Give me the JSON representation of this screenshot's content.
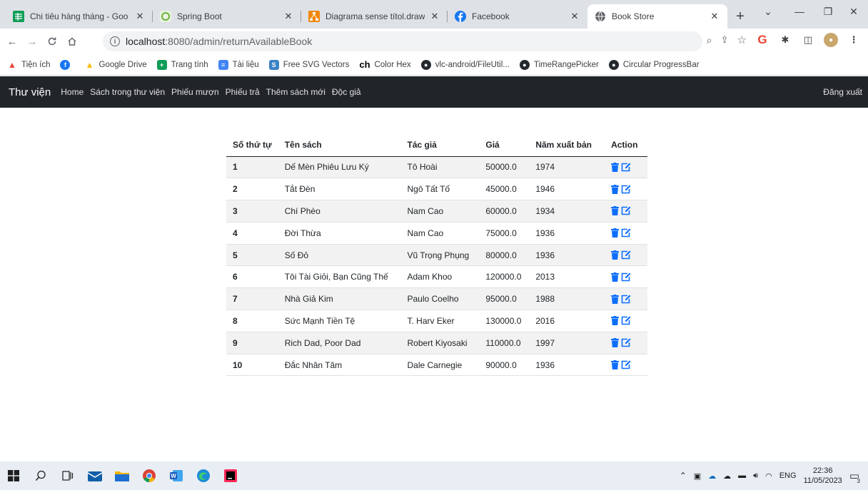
{
  "browser": {
    "tabs": [
      {
        "title": "Chi tiêu hàng tháng - Goo",
        "favicon": "sheets-icon",
        "color": "#0f9d58"
      },
      {
        "title": "Spring Boot",
        "favicon": "spring-icon",
        "color": "#6db33f"
      },
      {
        "title": "Diagrama sense títol.draw",
        "favicon": "drawio-icon",
        "color": "#f08705"
      },
      {
        "title": "Facebook",
        "favicon": "facebook-icon",
        "color": "#1877f2"
      },
      {
        "title": "Book Store",
        "favicon": "globe-icon",
        "color": "#5f6368"
      }
    ],
    "url_host": "localhost",
    "url_path": ":8080/admin/returnAvailableBook",
    "bookmarks": [
      {
        "label": "Tiện ích",
        "icon": "apps-icon",
        "color": "#ea4335"
      },
      {
        "label": "",
        "icon": "facebook-icon",
        "color": "#1877f2"
      },
      {
        "label": "Google Drive",
        "icon": "drive-icon",
        "color": "#fbbc04"
      },
      {
        "label": "Trang tính",
        "icon": "sheets-icon",
        "color": "#0f9d58"
      },
      {
        "label": "Tài liệu",
        "icon": "docs-icon",
        "color": "#4285f4"
      },
      {
        "label": "Free SVG Vectors",
        "icon": "svg-icon",
        "color": "#3b82c4"
      },
      {
        "label": "Color Hex",
        "icon": "colorhex-icon",
        "color": "#000000"
      },
      {
        "label": "vlc-android/FileUtil...",
        "icon": "github-icon",
        "color": "#24292f"
      },
      {
        "label": "TimeRangePicker",
        "icon": "github-icon",
        "color": "#24292f"
      },
      {
        "label": "Circular ProgressBar",
        "icon": "github-icon",
        "color": "#24292f"
      }
    ]
  },
  "navbar": {
    "brand": "Thư viện",
    "links": [
      "Home",
      "Sách trong thư viện",
      "Phiếu mượn",
      "Phiếu trả",
      "Thêm sách mới",
      "Độc giả"
    ],
    "logout": "Đăng xuất",
    "bg_color": "#212529"
  },
  "table": {
    "headers": [
      "Số thứ tự",
      "Tên sách",
      "Tác giả",
      "Giá",
      "Năm xuất bản",
      "Action"
    ],
    "rows": [
      [
        "1",
        "Dế Mèn Phiêu Lưu Ký",
        "Tô Hoài",
        "50000.0",
        "1974"
      ],
      [
        "2",
        "Tắt Đèn",
        "Ngô Tất Tố",
        "45000.0",
        "1946"
      ],
      [
        "3",
        "Chí Phèo",
        "Nam Cao",
        "60000.0",
        "1934"
      ],
      [
        "4",
        "Đời Thừa",
        "Nam Cao",
        "75000.0",
        "1936"
      ],
      [
        "5",
        "Số Đỏ",
        "Vũ Trọng Phụng",
        "80000.0",
        "1936"
      ],
      [
        "6",
        "Tôi Tài Giỏi, Bạn Cũng Thế",
        "Adam Khoo",
        "120000.0",
        "2013"
      ],
      [
        "7",
        "Nhà Giả Kim",
        "Paulo Coelho",
        "95000.0",
        "1988"
      ],
      [
        "8",
        "Sức Mạnh Tiền Tệ",
        "T. Harv Eker",
        "130000.0",
        "2016"
      ],
      [
        "9",
        "Rich Dad, Poor Dad",
        "Robert Kiyosaki",
        "110000.0",
        "1997"
      ],
      [
        "10",
        "Đắc Nhân Tâm",
        "Dale Carnegie",
        "90000.0",
        "1936"
      ]
    ],
    "action_icons": [
      "trash-icon",
      "edit-icon"
    ],
    "action_color": "#0d6efd"
  },
  "taskbar": {
    "language": "ENG",
    "time": "22:36",
    "date": "11/05/2023",
    "notification_count": "3"
  }
}
